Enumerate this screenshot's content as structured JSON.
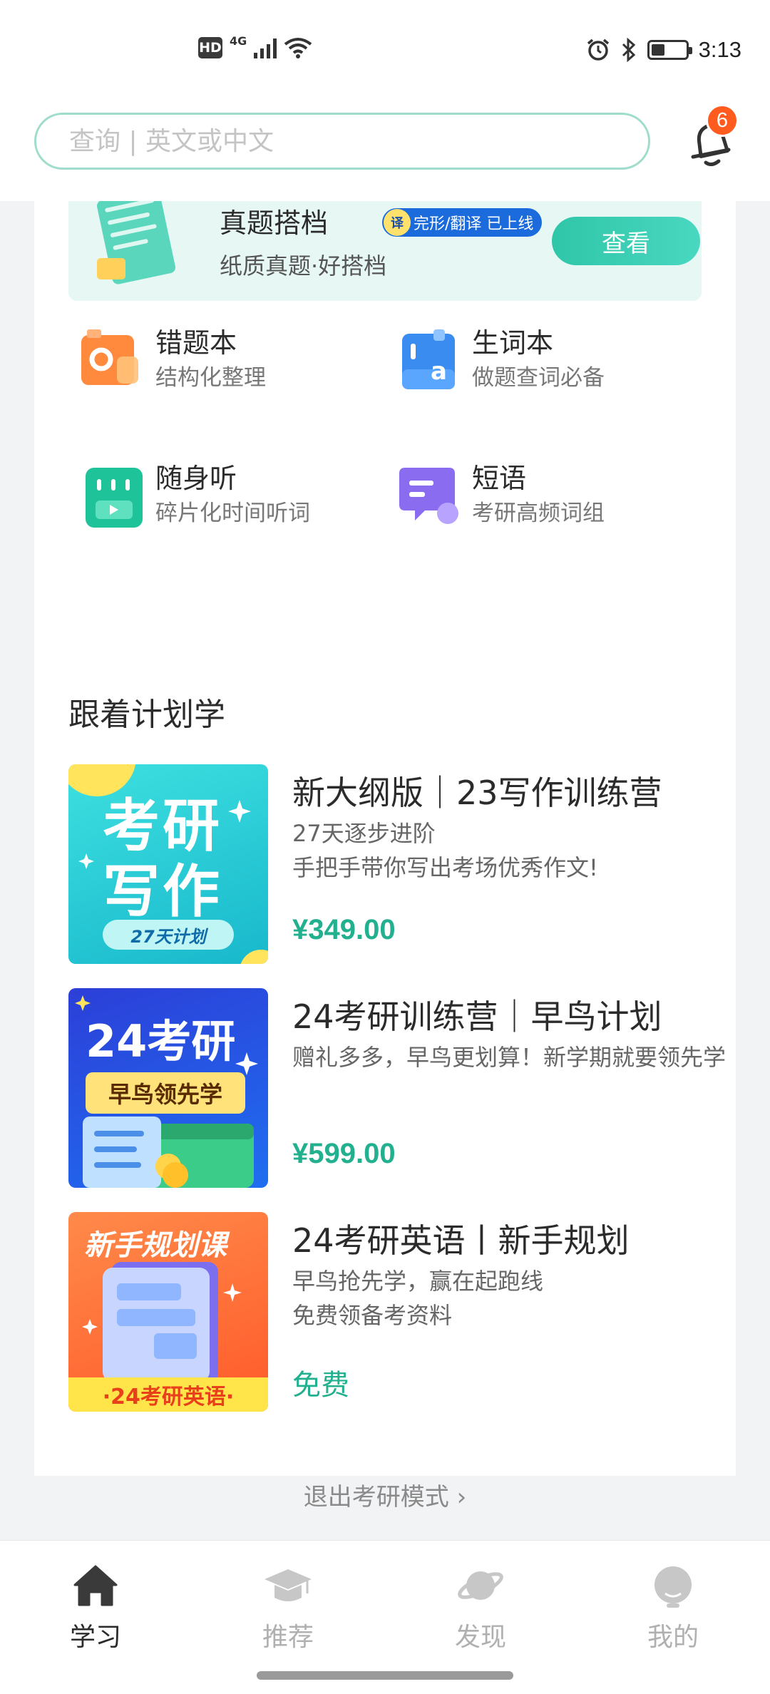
{
  "status_bar": {
    "hd": "HD",
    "network": "4G",
    "time": "3:13"
  },
  "search": {
    "placeholder": "查询 | 英文或中文"
  },
  "notifications": {
    "count": "6"
  },
  "banner": {
    "title": "真题搭档",
    "tag_icon": "译",
    "tag": "完形/翻译 已上线",
    "subtitle": "纸质真题·好搭档",
    "button": "查看"
  },
  "tools": [
    {
      "title": "错题本",
      "subtitle": "结构化整理",
      "icon": "wrong-book-icon"
    },
    {
      "title": "生词本",
      "subtitle": "做题查词必备",
      "icon": "vocab-book-icon"
    },
    {
      "title": "随身听",
      "subtitle": "碎片化时间听词",
      "icon": "listen-icon"
    },
    {
      "title": "短语",
      "subtitle": "考研高频词组",
      "icon": "phrase-icon"
    }
  ],
  "plan": {
    "title": "跟着计划学",
    "courses": [
      {
        "title": "新大纲版｜23写作训练营",
        "line1": "27天逐步进阶",
        "line2": "手把手带你写出考场优秀作文!",
        "price": "¥349.00",
        "thumb": {
          "line1": "考研",
          "line2": "写作",
          "badge": "27天计划"
        }
      },
      {
        "title": "24考研训练营｜早鸟计划",
        "line1": "赠礼多多，早鸟更划算！新学期就要领先学",
        "line2": "",
        "price": "¥599.00",
        "thumb": {
          "line1": "24考研",
          "badge": "早鸟领先学"
        }
      },
      {
        "title": "24考研英语丨新手规划",
        "line1": "早鸟抢先学，赢在起跑线",
        "line2": "免费领备考资料",
        "price": "免费",
        "thumb": {
          "line1": "新手规划课",
          "badge": "·24考研英语·"
        }
      }
    ]
  },
  "exit_link": "退出考研模式 ›",
  "tabbar": [
    {
      "label": "学习",
      "icon": "home-icon",
      "active": true
    },
    {
      "label": "推荐",
      "icon": "graduation-cap-icon",
      "active": false
    },
    {
      "label": "发现",
      "icon": "planet-icon",
      "active": false
    },
    {
      "label": "我的",
      "icon": "profile-icon",
      "active": false
    }
  ],
  "colors": {
    "accent": "#22b08f",
    "badge": "#ff5b1f",
    "search_border": "#9fdccc"
  }
}
